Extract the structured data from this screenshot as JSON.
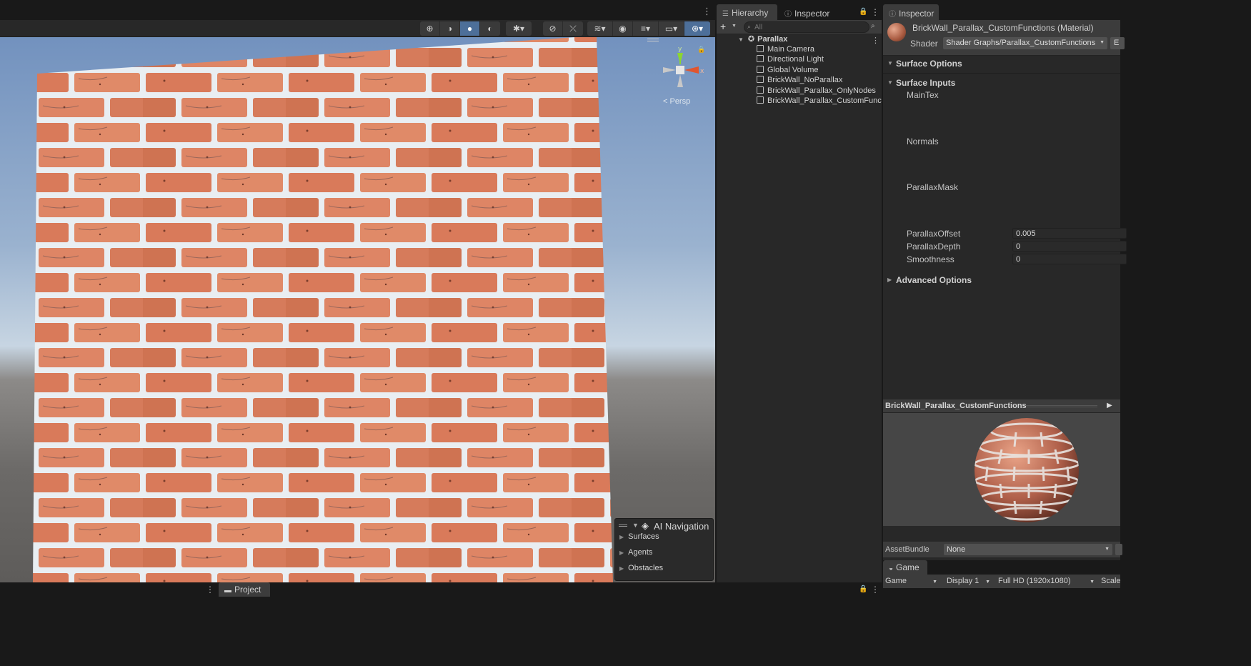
{
  "scene": {
    "persp_label": "< Persp",
    "gizmo_axes": {
      "x": "x",
      "y": "y"
    },
    "colors": {
      "brick": "#d97a5a",
      "mortar": "#e9eef2",
      "sky": "#9ab2cf",
      "gizmo_x": "#e0562f",
      "gizmo_y": "#8cd62f"
    },
    "ai_navigation": {
      "title": "AI Navigation",
      "items": [
        "Surfaces",
        "Agents",
        "Obstacles"
      ]
    }
  },
  "hierarchy": {
    "tab_label": "Hierarchy",
    "inspector_tab_label": "Inspector",
    "search_placeholder": "All",
    "root": "Parallax",
    "items": [
      "Main Camera",
      "Directional Light",
      "Global Volume",
      "BrickWall_NoParallax",
      "BrickWall_Parallax_OnlyNodes",
      "BrickWall_Parallax_CustomFunctions"
    ]
  },
  "inspector": {
    "tab_label": "Inspector",
    "title": "BrickWall_Parallax_CustomFunctions (Material)",
    "shader_label": "Shader",
    "shader_value": "Shader Graphs/Parallax_CustomFunctions",
    "shader_edit": "E",
    "sections": {
      "surface_options": "Surface Options",
      "surface_inputs": "Surface Inputs",
      "advanced_options": "Advanced Options"
    },
    "textures": [
      "MainTex",
      "Normals",
      "ParallaxMask"
    ],
    "props": [
      {
        "label": "ParallaxOffset",
        "value": "0.005"
      },
      {
        "label": "ParallaxDepth",
        "value": "0"
      },
      {
        "label": "Smoothness",
        "value": "0"
      }
    ],
    "preview_title": "BrickWall_Parallax_CustomFunctions",
    "assetbundle_label": "AssetBundle",
    "assetbundle_value": "None"
  },
  "game": {
    "tab_label": "Game",
    "mode": "Game",
    "display": "Display 1",
    "resolution": "Full HD (1920x1080)",
    "scale_label": "Scale"
  },
  "project": {
    "tab_label": "Project"
  }
}
